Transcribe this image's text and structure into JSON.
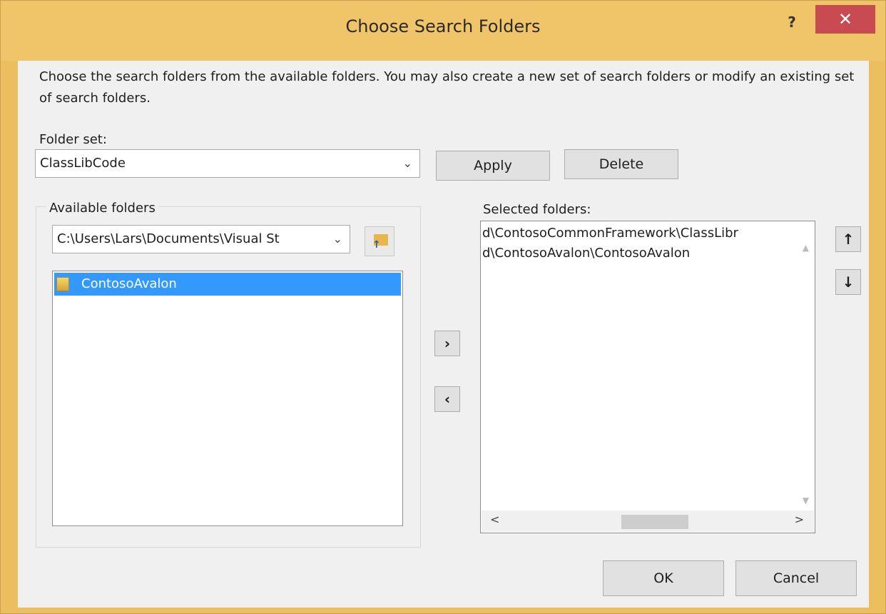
{
  "window": {
    "title": "Choose Search Folders",
    "help_label": "?",
    "close_label": "✕"
  },
  "description": "Choose the search folders from the available folders. You may also create a new set of search folders or modify an existing set of search folders.",
  "folder_set": {
    "label": "Folder set:",
    "value": "ClassLibCode",
    "apply_label": "Apply",
    "delete_label": "Delete"
  },
  "available": {
    "group_label": "Available folders",
    "path_value": "C:\\Users\\Lars\\Documents\\Visual St",
    "items": [
      {
        "label": "ContosoAvalon"
      }
    ]
  },
  "transfer": {
    "add_label": "›",
    "remove_label": "‹"
  },
  "selected": {
    "label": "Selected folders:",
    "items": [
      {
        "label": "d\\ContosoCommonFramework\\ClassLibr"
      },
      {
        "label": "d\\ContosoAvalon\\ContosoAvalon"
      }
    ],
    "move_up_label": "↑",
    "move_down_label": "↓"
  },
  "footer": {
    "ok_label": "OK",
    "cancel_label": "Cancel"
  },
  "colors": {
    "titlebar": "#f0c468",
    "close": "#c74b50",
    "selection": "#3399ff"
  }
}
